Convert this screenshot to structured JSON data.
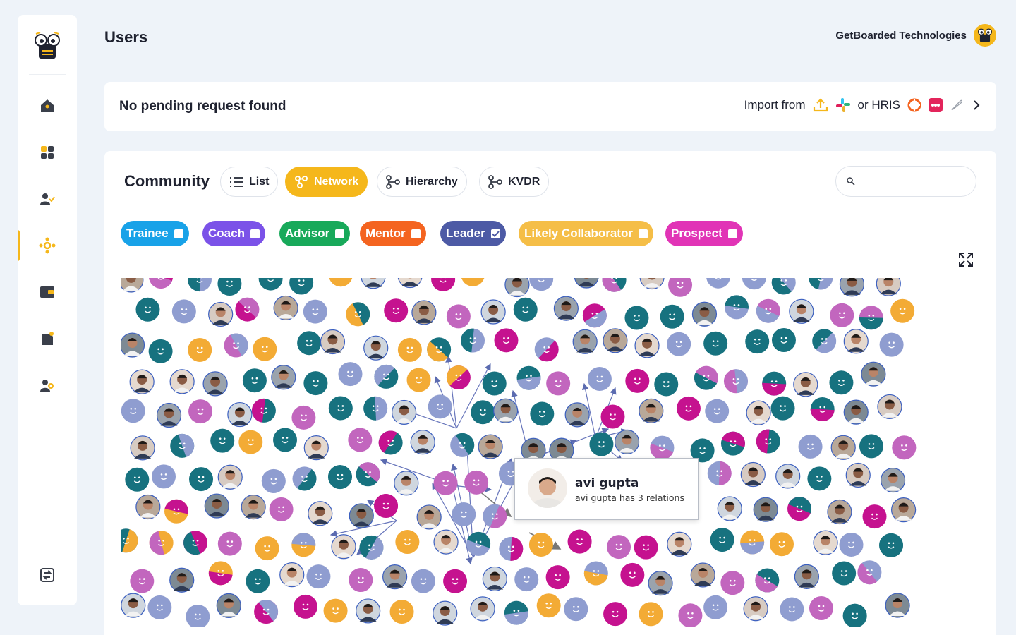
{
  "header": {
    "title": "Users",
    "org_name": "GetBoarded Technologies"
  },
  "sidebar": {
    "items": [
      {
        "id": "home",
        "icon": "home-icon"
      },
      {
        "id": "dashboard",
        "icon": "grid-icon"
      },
      {
        "id": "users",
        "icon": "user-check-icon"
      },
      {
        "id": "network",
        "icon": "network-icon",
        "active": true
      },
      {
        "id": "wallet",
        "icon": "wallet-icon"
      },
      {
        "id": "tasks",
        "icon": "note-icon"
      },
      {
        "id": "team",
        "icon": "team-gear-icon"
      },
      {
        "id": "switch",
        "icon": "switch-icon"
      }
    ]
  },
  "pending": {
    "message": "No pending request found",
    "import_label": "Import from",
    "or_hris": "or HRIS"
  },
  "community": {
    "title": "Community",
    "views": [
      {
        "label": "List",
        "icon": "list-icon"
      },
      {
        "label": "Network",
        "icon": "network-icon",
        "active": true
      },
      {
        "label": "Hierarchy",
        "icon": "hierarchy-icon"
      },
      {
        "label": "KVDR",
        "icon": "hierarchy-icon"
      }
    ],
    "search": {
      "value": "",
      "placeholder": ""
    },
    "filters": [
      {
        "label": "Trainee",
        "color": "#18a2e8",
        "checked": false
      },
      {
        "label": "Coach",
        "color": "#7b52e8",
        "checked": false
      },
      {
        "label": "Advisor",
        "color": "#18a95a",
        "checked": false
      },
      {
        "label": "Mentor",
        "color": "#f46420",
        "checked": false
      },
      {
        "label": "Leader",
        "color": "#4d5aa5",
        "checked": true
      },
      {
        "label": "Likely Collaborator",
        "color": "#f5be47",
        "checked": false
      },
      {
        "label": "Prospect",
        "color": "#e134b6",
        "checked": false
      }
    ]
  },
  "tooltip": {
    "name": "avi gupta",
    "subtitle": "avi gupta has 3 relations"
  },
  "colors": {
    "accent": "#f5b71b",
    "node_teal": "#17727f",
    "node_magenta": "#c5128f",
    "node_orange": "#f3ab35",
    "node_lavender": "#8f9dd0",
    "node_pink": "#c266be"
  }
}
